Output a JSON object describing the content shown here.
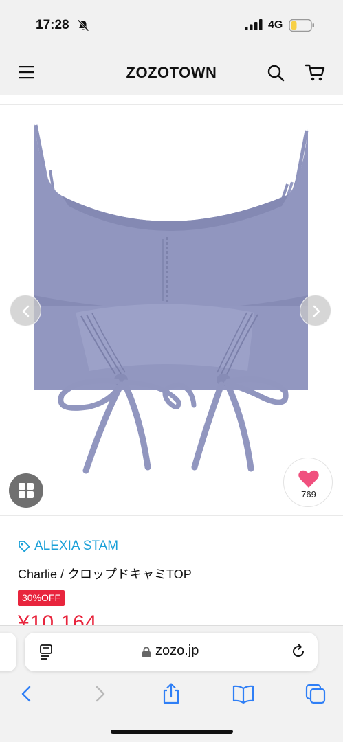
{
  "status_bar": {
    "time": "17:28",
    "network": "4G",
    "battery_color": "#f7d046"
  },
  "header": {
    "logo": "ZOZOTOWN",
    "background": "#f1f1f1"
  },
  "product_image": {
    "like_count": "769",
    "garment_color": "#9196bf"
  },
  "product": {
    "brand": "ALEXIA STAM",
    "brand_color": "#1aa0d8",
    "name": "Charlie / クロップドキャミTOP",
    "discount_badge": "30%OFF",
    "price": "¥10,164",
    "accent_color": "#e8253d"
  },
  "browser": {
    "url": "zozo.jp"
  },
  "icons": {
    "header": [
      "menu-icon",
      "search-icon",
      "cart-icon"
    ],
    "browser_toolbar": [
      "back-icon",
      "forward-icon",
      "share-icon",
      "bookmarks-icon",
      "tabs-icon"
    ]
  }
}
